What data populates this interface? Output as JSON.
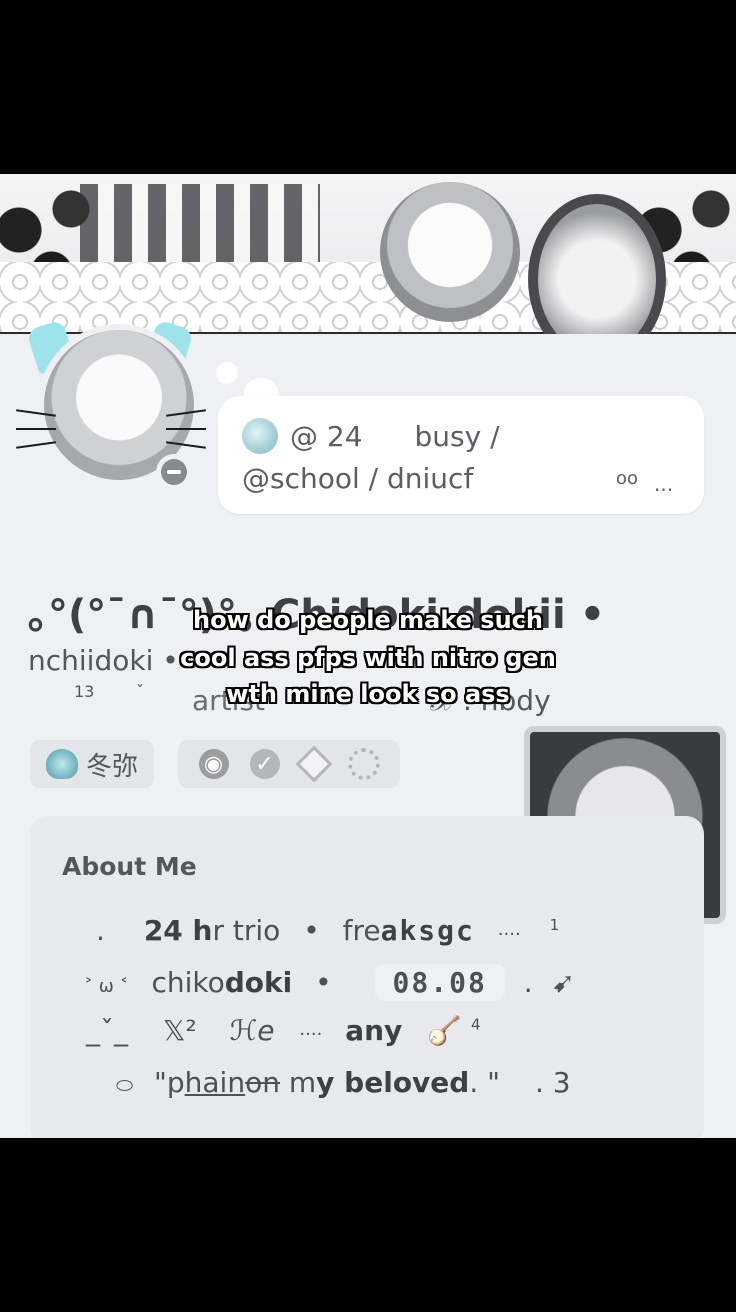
{
  "status_card": {
    "icon": "globe-icon",
    "line1_a": "@ 24",
    "line1_b": "busy /",
    "line2": "@school / dniucf",
    "oo": "oo",
    "dots": "..."
  },
  "profile": {
    "display_name": "｡°(°¯∩¯°)°｡ Chidoki-dokii •",
    "username": "nchiidoki •",
    "sub_number": "13",
    "sub_v": "ˇ",
    "pronoun_fragment": "artist",
    "right_fragment": "𝒳 . nbdy"
  },
  "caption": {
    "line1": "how do people make such",
    "line2": "cool ass pfps with nitro gen",
    "line3": "wth mine look so ass"
  },
  "tag": {
    "icon": "cat-icon",
    "label": "冬弥"
  },
  "badges": [
    "nitro-badge-icon",
    "check-badge-icon",
    "diamond-badge-icon",
    "laurel-badge-icon"
  ],
  "about": {
    "title": "About Me",
    "row1": {
      "dot": ".",
      "bold": "24 h",
      "rest": "r trio",
      "sep": "•",
      "fre": "fre",
      "aksgc": "aksgc",
      "dashes": "····",
      "sup": "1"
    },
    "row2": {
      "face": "˃ ω ˂",
      "chi": "chiko",
      "doki": "doki",
      "sep": "•",
      "date": "08.08",
      "dot": ".",
      "arrow": "➹"
    },
    "row3": {
      "v": "_ˇ_",
      "x": "𝕏²",
      "he": "ℋe",
      "dashes": "····",
      "any": "any",
      "harp": "🪕",
      "sup": "4"
    },
    "row4": {
      "oval": "⬭",
      "q1": "\"p",
      "hain": "hain",
      "on": "on",
      "m": " m",
      "y": "y",
      "beloved": " beloved",
      "q2": ". \"",
      "end": ". 3"
    }
  }
}
